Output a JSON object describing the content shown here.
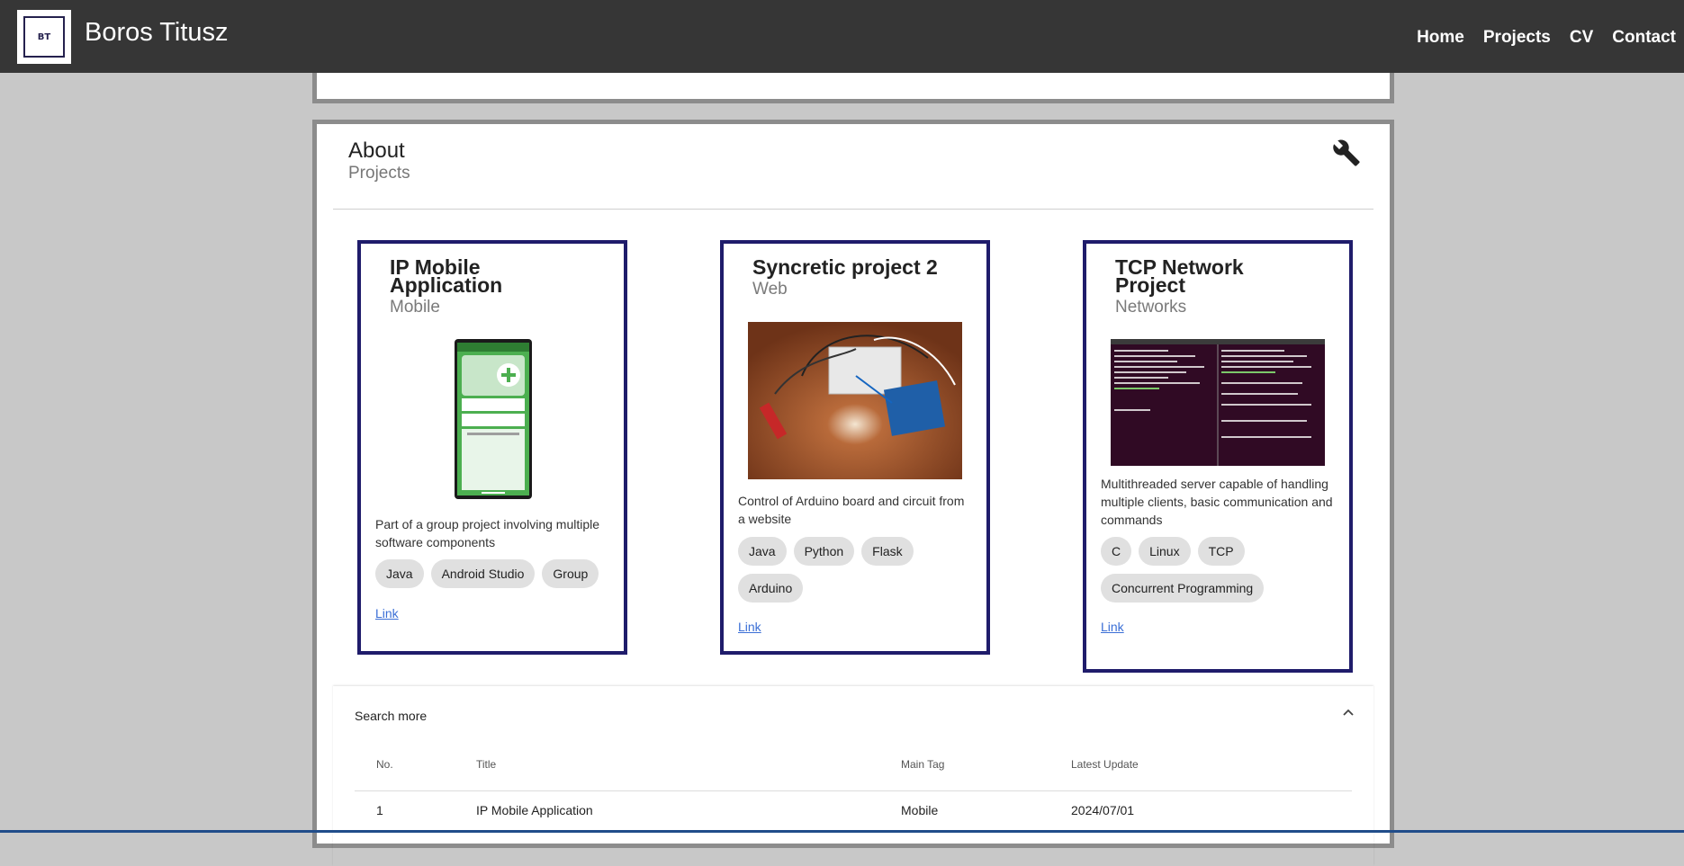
{
  "header": {
    "logo_text": "BT",
    "site_name": "Boros Titusz",
    "nav": [
      "Home",
      "Projects",
      "CV",
      "Contact"
    ]
  },
  "section": {
    "title": "About",
    "subtitle": "Projects",
    "icon": "wrench-icon"
  },
  "cards": [
    {
      "title_line1": "IP Mobile",
      "title_line2": "Application",
      "category": "Mobile",
      "image": "phone-screenshot",
      "description": "Part of a group project involving multiple software components",
      "tags": [
        "Java",
        "Android Studio",
        "Group"
      ],
      "link": "Link"
    },
    {
      "title_line1": "Syncretic project 2",
      "title_line2": "",
      "category": "Web",
      "image": "arduino-photo",
      "description": "Control of Arduino board and circuit from a website",
      "tags": [
        "Java",
        "Python",
        "Flask",
        "Arduino"
      ],
      "link": "Link"
    },
    {
      "title_line1": "TCP Network",
      "title_line2": "Project",
      "category": "Networks",
      "image": "terminal-screenshot",
      "description": "Multithreaded server capable of handling multiple clients, basic communication and commands",
      "tags": [
        "C",
        "Linux",
        "TCP",
        "Concurrent Programming"
      ],
      "link": "Link"
    }
  ],
  "search": {
    "label": "Search more",
    "columns": [
      "No.",
      "Title",
      "Main Tag",
      "Latest Update"
    ],
    "rows": [
      {
        "no": "1",
        "title": "IP Mobile Application",
        "tag": "Mobile",
        "updated": "2024/07/01"
      }
    ]
  },
  "colors": {
    "header_bg": "#363636",
    "card_border": "#1f1c6b",
    "page_bg": "#c8c8c8",
    "link": "#3b6fd6"
  }
}
